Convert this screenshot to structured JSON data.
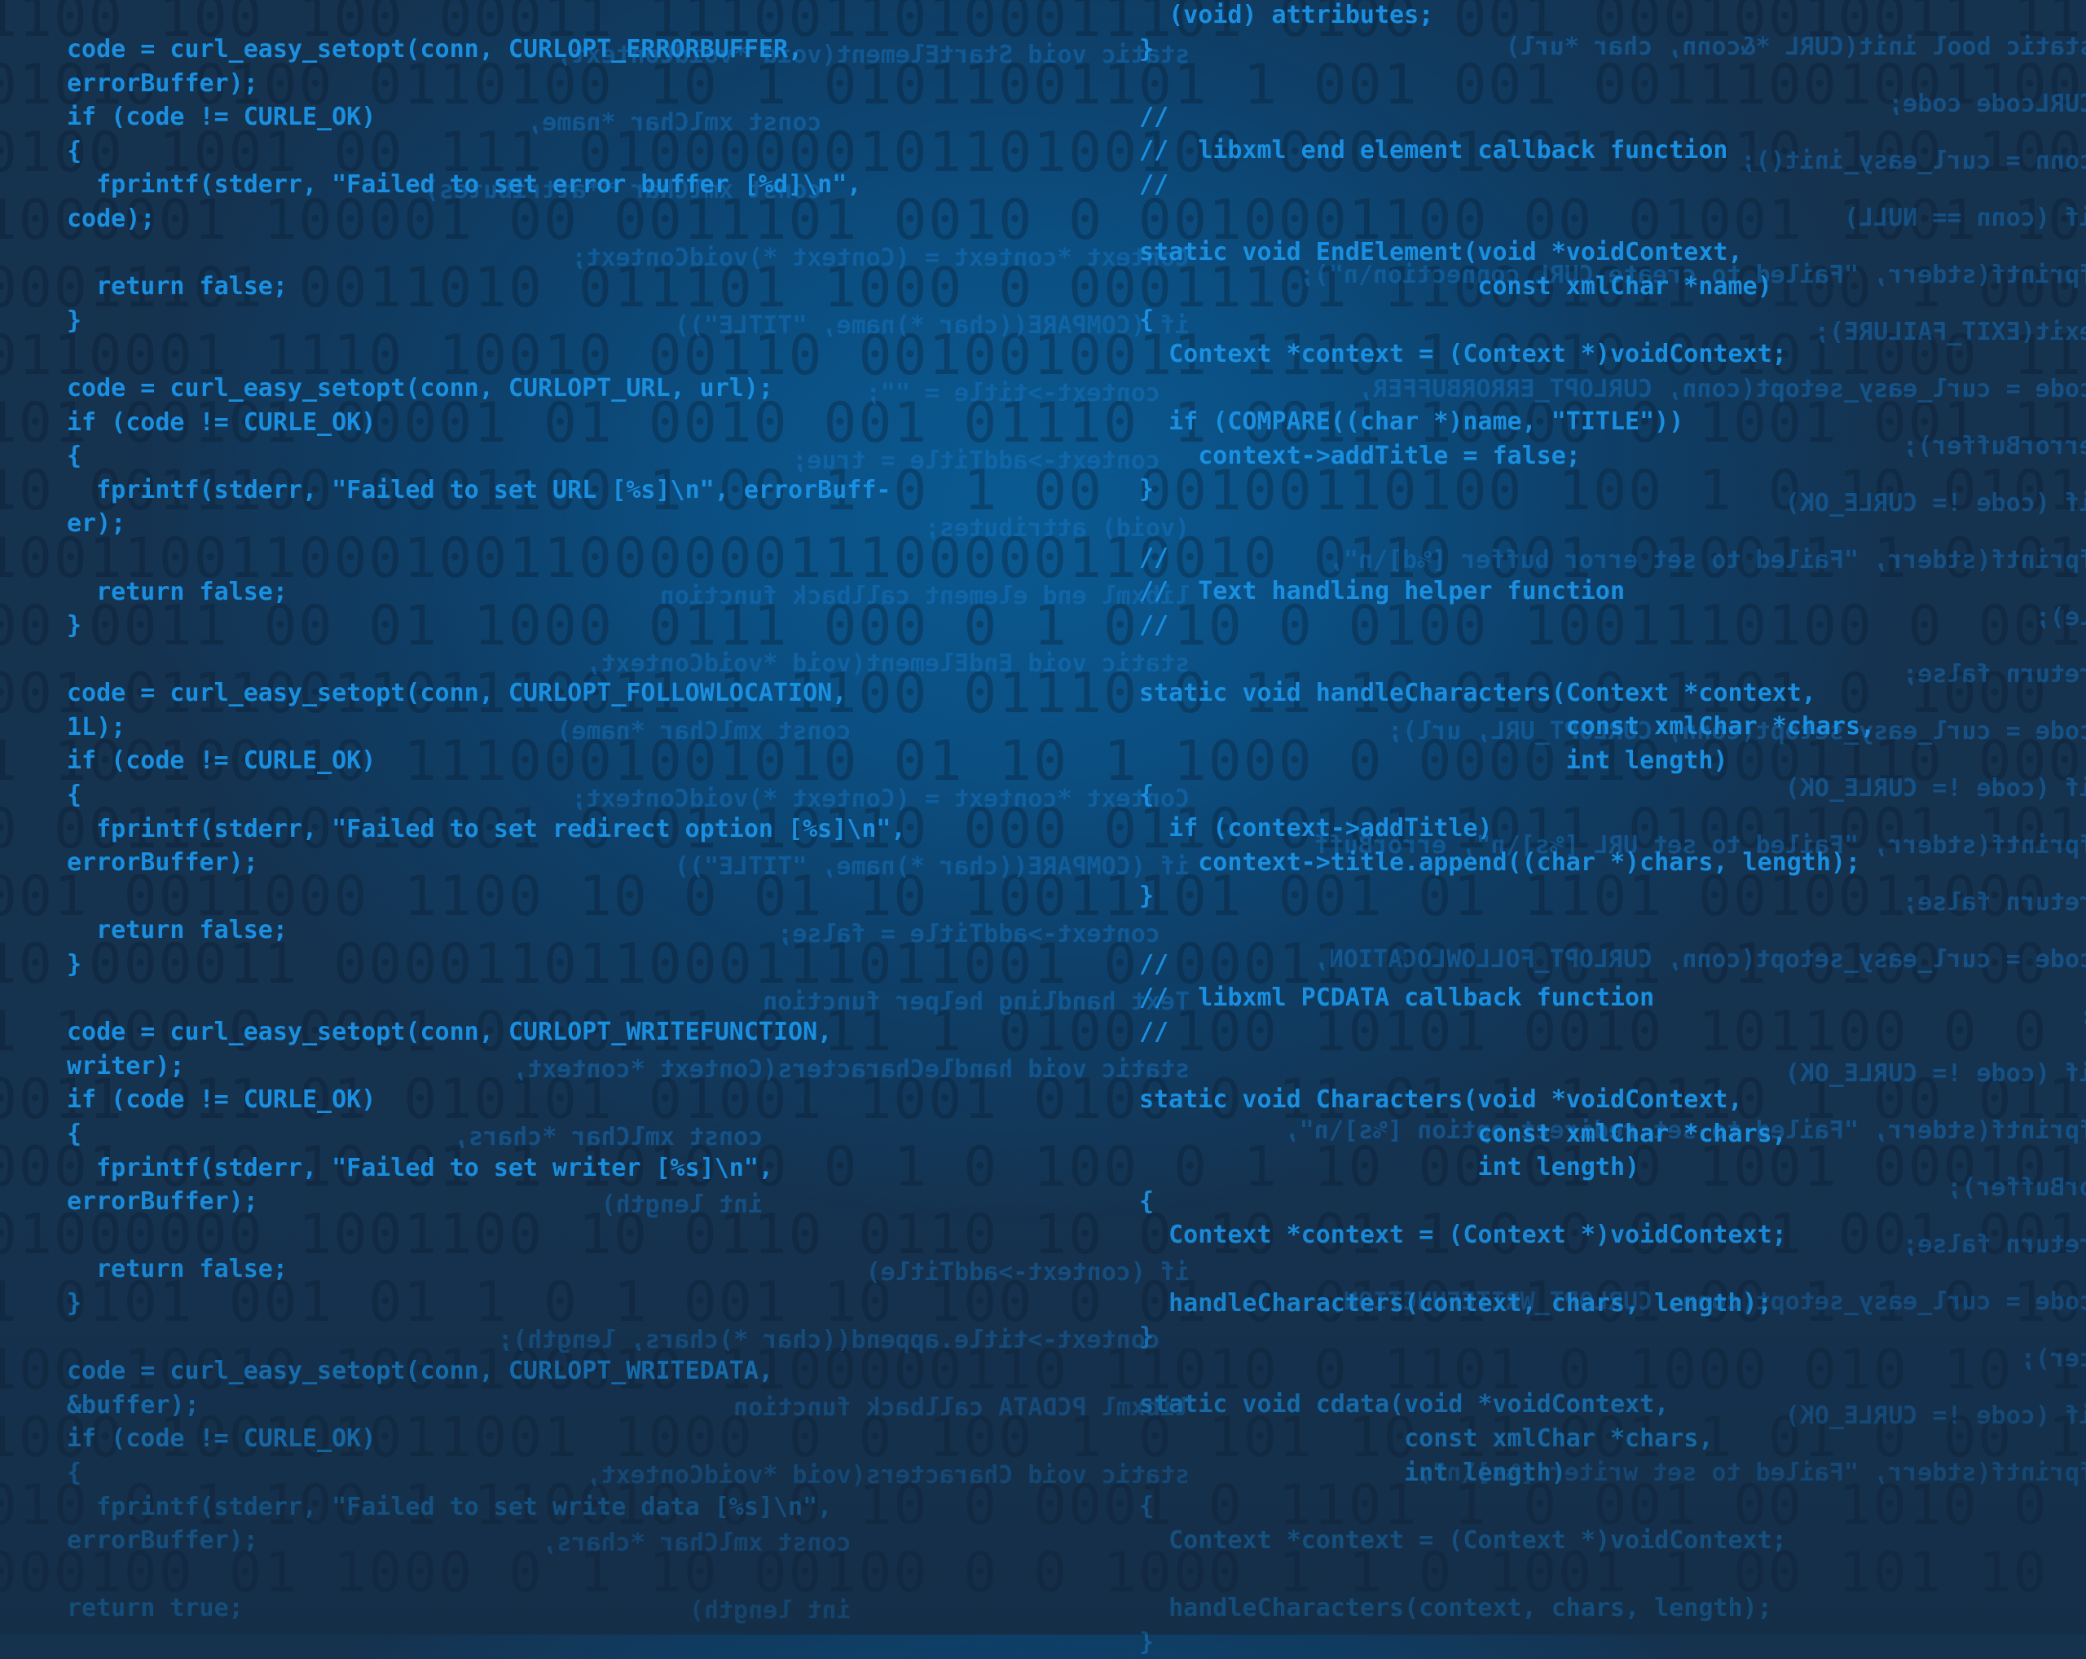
{
  "binary_rows": [
    "1100 100 100 00011 11100110100011101 0100 001 00010010011 111 0110001 01110",
    "01010 0100 0110100 10 1 01011001101 1 001 001 0011100100110000 01100011",
    "0100 1001 00 111 0100000010110100100 000001001100010 100 1001 11000 1001001",
    "1000001 100001 00 0011101 0010 0 0010001100 00 01001 1001 100110000 0",
    "00011101 0011010 011101 1000 0 00011101 110001011 0100 1 000 100001111000",
    "0110001 1110 10010 00110 0010010011 1110 1 0010 001011000 1100000 110",
    "101 00101 00001 01 0010 001 01110 1 0011 10000 0 1001 001 1110 01 1100 0110",
    "10 0011100 0001100 1 00 1 0 1 00 00100110100 100 1 0 10 0101 1 0 01 0 0111",
    "1001100110001001100000011100000110010 0110 001 010011 1 0 01 0011 1 11",
    "00 0011 00 01 1000 0111 000 0 1 0 10 0 0100 1001110100 0 0010011001 0 0110",
    "001 0111001101110011 1 1100 01110 0 11 10 010 0 1101 0 1000 1 0 00010101",
    "1 100100010 1110001001010 01 10 1 1000 0 0000110 0001110 00011001",
    "0 00111 00010001 0 01 10110 000 0110 0101 1011 010011001 101100 001100",
    "001 0011000 1100 10 0 01 10 10011101 001 01 1101 0010011000 0 11 1100",
    "10 000011 000011011000111011001 0 00011 001 0011 01 0100 00 11 1010 01 01",
    "1 1000 0 0001 0000111 0 11 1 0100 100 10101 0010 101100 0 0 1 1 0011110",
    "0011 011 01 010101 01001 1001 0100 0 11 01 1 1 0110 1 00 0110001 0001 1 1",
    "0001 010 10 01 1 1010 0 0 1 0 100 0 1 10 00 01 0 1001 0001011 1 01 01 1 1",
    "01000000 1001100 10 0110 0110 10 0 10 01 1 0 0 01001 001 0010 1 0 0 100 0",
    "1 0101 001 01 1 0 1 001 10 100 0 01 0 01101 1 01 00 1 1 0 10 00 01 1 1 001",
    "100 10010 1001100010 1100000110 11010 0 1101 0 1000 010 10 100 0101100",
    "1000 100101011001 1000 0 0 100 1 0 101 10 11 001 1 01 0 00 101 01 001",
    "010 0 1 100 1 110010 0 0 10 0 0001 0 1101 1 0 001 00 1010 0 0 0 0 01 10 01",
    "000100 01 1000 0 1 10 00100 0 0 1000 1 1 0 1001 1 00 101 10 0 0 1 01 01 00"
  ],
  "mirror_code": [
    "static void StartElement(void *voidContext,",
    "                         const xmlChar *name,",
    "                         const xmlChar **attributes)",
    "Context *context = (Context *)voidContext;",
    "if (COMPARE((char *)name, \"TITLE\"))",
    "  context->title = \"\";",
    "  context->addTitle = true;",
    "(void) attributes;",
    "libxml end element callback function",
    "static void EndElement(void *voidContext,",
    "                       const xmlChar *name)",
    "Context *context = (Context *)voidContext;",
    "if (COMPARE((char *)name, \"TITLE\"))",
    "  context->addTitle = false;",
    "Text handling helper function",
    "static void handleCharacters(Context *context,",
    "                             const xmlChar *chars,",
    "                             int length)",
    "if (context->addTitle)",
    "  context->title.append((char *)chars, length);",
    "libxml PCDATA callback function",
    "static void Characters(void *voidContext,",
    "                       const xmlChar *chars,",
    "                       int length)",
    "static bool init(CURL *&conn, char *url)",
    "CURLcode code;",
    "conn = curl_easy_init();",
    "if (conn == NULL)",
    "fprintf(stderr, \"Failed to create CURL connection\\n\");",
    "exit(EXIT_FAILURE);",
    "code = curl_easy_setopt(conn, CURLOPT_ERRORBUFFER,",
    "errorBuffer);",
    "if (code != CURLE_OK)",
    "fprintf(stderr, \"Failed to set error buffer [%d]\\n\",",
    "le);",
    "return false;",
    "code = curl_easy_setopt(conn, CURLOPT_URL, url);",
    "if (code != CURLE_OK)",
    "fprintf(stderr, \"Failed to set URL [%s]\\n\", errorBuff",
    "return false;",
    "code = curl_easy_setopt(conn, CURLOPT_FOLLOWLOCATION,",
    ";",
    "if (code != CURLE_OK)",
    "fprintf(stderr, \"Failed to set redirect option [%s]\\n\",",
    "orBuffer);",
    "return false;",
    "code = curl_easy_setopt(conn, CURLOPT_WRITEFUNCTION,",
    "ter);",
    "if (code != CURLE_OK)",
    "fprintf(stderr, \"Failed to set writer [%s]\\n\","
  ],
  "left_code": [
    "code = curl_easy_setopt(conn, CURLOPT_ERRORBUFFER,",
    "errorBuffer);",
    "if (code != CURLE_OK)",
    "{",
    "  fprintf(stderr, \"Failed to set error buffer [%d]\\n\",",
    "code);",
    "",
    "  return false;",
    "}",
    "",
    "code = curl_easy_setopt(conn, CURLOPT_URL, url);",
    "if (code != CURLE_OK)",
    "{",
    "  fprintf(stderr, \"Failed to set URL [%s]\\n\", errorBuff-",
    "er);",
    "",
    "  return false;",
    "}",
    "",
    "code = curl_easy_setopt(conn, CURLOPT_FOLLOWLOCATION,",
    "1L);",
    "if (code != CURLE_OK)",
    "{",
    "  fprintf(stderr, \"Failed to set redirect option [%s]\\n\",",
    "errorBuffer);",
    "",
    "  return false;",
    "}",
    "",
    "code = curl_easy_setopt(conn, CURLOPT_WRITEFUNCTION,",
    "writer);",
    "if (code != CURLE_OK)",
    "{",
    "  fprintf(stderr, \"Failed to set writer [%s]\\n\",",
    "errorBuffer);",
    "",
    "  return false;",
    "}",
    "",
    "code = curl_easy_setopt(conn, CURLOPT_WRITEDATA,",
    "&buffer);",
    "if (code != CURLE_OK)",
    "{",
    "  fprintf(stderr, \"Failed to set write data [%s]\\n\",",
    "errorBuffer);",
    "",
    "return true;"
  ],
  "right_code": [
    "  (void) attributes;",
    "}",
    "",
    "//",
    "//  libxml end element callback function",
    "//",
    "",
    "static void EndElement(void *voidContext,",
    "                       const xmlChar *name)",
    "{",
    "  Context *context = (Context *)voidContext;",
    "",
    "  if (COMPARE((char *)name, \"TITLE\"))",
    "    context->addTitle = false;",
    "}",
    "",
    "//",
    "//  Text handling helper function",
    "//",
    "",
    "static void handleCharacters(Context *context,",
    "                             const xmlChar *chars,",
    "                             int length)",
    "{",
    "  if (context->addTitle)",
    "    context->title.append((char *)chars, length);",
    "}",
    "",
    "//",
    "//  libxml PCDATA callback function",
    "//",
    "",
    "static void Characters(void *voidContext,",
    "                       const xmlChar *chars,",
    "                       int length)",
    "{",
    "  Context *context = (Context *)voidContext;",
    "",
    "  handleCharacters(context, chars, length);",
    "}",
    "",
    "static void cdata(void *voidContext,",
    "                  const xmlChar *chars,",
    "                  int length)",
    "{",
    "  Context *context = (Context *)voidContext;",
    "",
    "  handleCharacters(context, chars, length);",
    "}"
  ]
}
